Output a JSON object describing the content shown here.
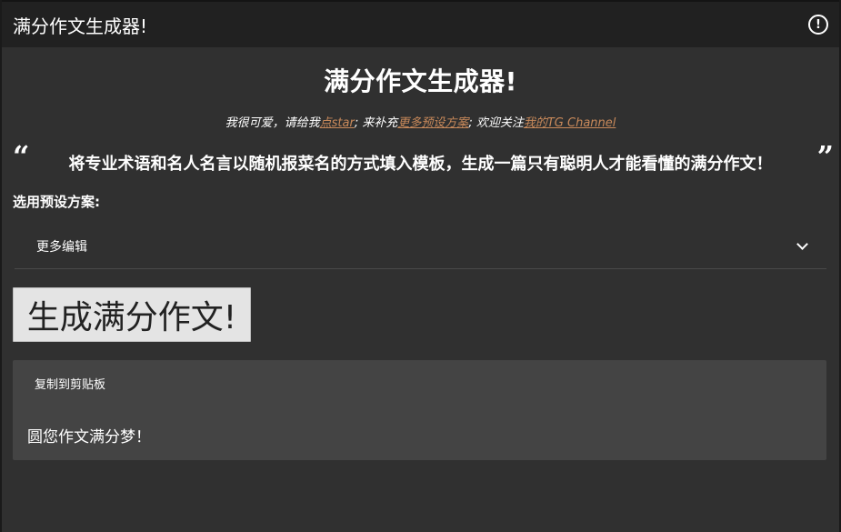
{
  "header": {
    "app_title": "满分作文生成器!",
    "info_icon": "info-circle-icon"
  },
  "main": {
    "headline": "满分作文生成器!",
    "subline": {
      "part1": "我很可爱，请给我",
      "link_star": "点star",
      "part2": "; 来补充",
      "link_more": "更多预设方案",
      "part3": "; 欢迎关注",
      "link_channel": "我的TG Channel"
    },
    "quote_open": "“",
    "quote_text": "将专业术语和名人名言以随机报菜名的方式填入模板，生成一篇只有聪明人才能看懂的满分作文！",
    "quote_close": "”",
    "preset_label": "选用预设方案:",
    "preset_select": {
      "selected": "更多编辑"
    },
    "generate_button": "生成满分作文!",
    "output": {
      "copy_button": "复制到剪贴板",
      "text": "圆您作文满分梦！"
    }
  },
  "colors": {
    "background": "#303030",
    "topbar": "#212121",
    "link": "#c8895a",
    "card": "#444444",
    "button": "#e4e4e4"
  }
}
